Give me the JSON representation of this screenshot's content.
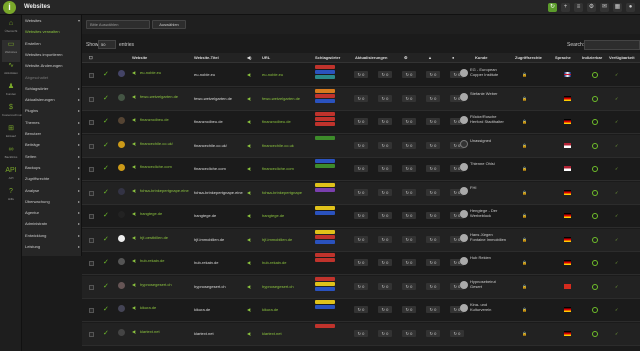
{
  "app": {
    "title": "Websites",
    "logo": "i"
  },
  "toolbar": {
    "icons": [
      "refresh-icon",
      "plus-icon",
      "list-icon",
      "gear-icon",
      "chat-icon",
      "grid-icon"
    ]
  },
  "leftnav": [
    {
      "label": "Übersicht",
      "icon": "home-icon"
    },
    {
      "label": "Websites",
      "icon": "monitor-icon"
    },
    {
      "label": "Aktivitäten",
      "icon": "activity-icon"
    },
    {
      "label": "Kunden",
      "icon": "users-icon"
    },
    {
      "label": "Kostenrechnung",
      "icon": "dollar-icon"
    },
    {
      "label": "Einkauf",
      "icon": "cart-icon"
    },
    {
      "label": "Backlinks",
      "icon": "link-icon"
    },
    {
      "label": "API",
      "icon": "api-icon"
    },
    {
      "label": "Hilfe",
      "icon": "help-icon"
    }
  ],
  "menu": [
    {
      "label": "Websites",
      "arrow": "▾"
    },
    {
      "label": "Websites verwalten",
      "arrow": ""
    },
    {
      "label": "Erstellen",
      "arrow": ""
    },
    {
      "label": "Websites importieren",
      "arrow": ""
    },
    {
      "label": "Website-Änderungen",
      "arrow": ""
    },
    {
      "label": "Abgeschaltet",
      "arrow": ""
    },
    {
      "label": "Schlagwörter",
      "arrow": "▸"
    },
    {
      "label": "Aktualisierungen",
      "arrow": "▸"
    },
    {
      "label": "Plugins",
      "arrow": "▸"
    },
    {
      "label": "Themes",
      "arrow": "▸"
    },
    {
      "label": "Benutzer",
      "arrow": "▸"
    },
    {
      "label": "Beiträge",
      "arrow": "▸"
    },
    {
      "label": "Seiten",
      "arrow": "▸"
    },
    {
      "label": "Backups",
      "arrow": "▸"
    },
    {
      "label": "Zugriffsrechte",
      "arrow": "▸"
    },
    {
      "label": "Analyse",
      "arrow": "▸"
    },
    {
      "label": "Überwachung",
      "arrow": "▸"
    },
    {
      "label": "Agentur",
      "arrow": "▸"
    },
    {
      "label": "Administratn",
      "arrow": "▸"
    },
    {
      "label": "Entwicklung",
      "arrow": "▸"
    },
    {
      "label": "Leistung",
      "arrow": "▸"
    }
  ],
  "filter": {
    "placeholder": "Bitte Auswählen",
    "button": "Auswählen"
  },
  "table_controls": {
    "show": "Show",
    "count": "50",
    "entries": "entries",
    "search": "Search:"
  },
  "columns": [
    "Website",
    "Website-Titel",
    "URL",
    "Schlagwörter",
    "Aktualisierungen",
    "Kunde",
    "Zugriffsrechte",
    "Sprache",
    "Indizierbar",
    "Verfügbarkeit"
  ],
  "rows": [
    {
      "site": "eu-noble.eu",
      "title": "eu-noble.eu",
      "url": "eu-noble.eu",
      "tags": [
        "red",
        "blue",
        "teal"
      ],
      "customer": "EG - European Copper Institute",
      "flag": "uk",
      "thumb": "#446"
    },
    {
      "site": "fewo-wetzelgarten.de",
      "title": "fewo-wetzelgarten.de",
      "url": "fewo-wetzelgarten.de",
      "tags": [
        "orange",
        "red",
        "blue"
      ],
      "customer": "Stefanie Weber",
      "flag": "de",
      "thumb": "#454"
    },
    {
      "site": "finanzrodbeu.de",
      "title": "finanzrodbeu.de",
      "url": "finanzrodbeu.de",
      "tags": [
        "red",
        "red",
        "red"
      ],
      "customer": "Flöcke/Rosche Herford Stadthalter",
      "flag": "de",
      "thumb": "#543"
    },
    {
      "site": "financechile.co.uk/",
      "title": "financechile.co.uk/",
      "url": "financechile.co.uk",
      "tags": [
        "green"
      ],
      "customer": "Unassigned",
      "flag": "us",
      "thumb": "#cc9a18"
    },
    {
      "site": "financecliche.com",
      "title": "financecliche.com",
      "url": "financecliche.com",
      "tags": [
        "blue",
        "green"
      ],
      "customer": "Thienne Ohlsi",
      "flag": "us",
      "thumb": "#cc9a18"
    },
    {
      "site": "fohsa-brinkepertgnape.eine",
      "title": "fohsa-brinkepertgnape.eine",
      "url": "fohsa-brinkepertgnape",
      "tags": [
        "yellow",
        "purple"
      ],
      "customer": "FHI",
      "flag": "de",
      "thumb": "#334"
    },
    {
      "site": "hangtege.de",
      "title": "hangtege.de",
      "url": "hangtege.de",
      "tags": [
        "yellow",
        "blue"
      ],
      "customer": "Hengtege - Der Werbeblock",
      "flag": "de",
      "thumb": "#222"
    },
    {
      "site": "hjf-oestbillen.de",
      "title": "hjf-immobilien.de",
      "url": "hjf-immobilien.de",
      "tags": [
        "yellow",
        "red",
        "blue"
      ],
      "customer": "Hans Jürgen Fontaine Immobilien",
      "flag": "de",
      "thumb": "#eee"
    },
    {
      "site": "hub-rekain.de",
      "title": "hub-rekain.de",
      "url": "hub-rekain.de",
      "tags": [
        "red",
        "red"
      ],
      "customer": "Hub Rekien",
      "flag": "de",
      "thumb": "#555"
    },
    {
      "site": "hypnosegesert.ch",
      "title": "hypnosegesert.ch",
      "url": "hypnosegesert.ch",
      "tags": [
        "red",
        "yellow",
        "blue"
      ],
      "customer": "Hypnosebeirut Gesert",
      "flag": "ch",
      "thumb": "#655"
    },
    {
      "site": "kikura.de",
      "title": "kikura.de",
      "url": "kikura.de",
      "tags": [
        "yellow",
        "blue"
      ],
      "customer": "Kina- und Kulturverein",
      "flag": "de",
      "thumb": "#445"
    },
    {
      "site": "klartext.net",
      "title": "klartext.net",
      "url": "klartext.net",
      "tags": [
        "red"
      ],
      "customer": "",
      "flag": "de",
      "thumb": "#444"
    }
  ],
  "colors": {
    "accent": "#8dc63f",
    "bg": "#1b1b1b",
    "red": "#c0332c",
    "blue": "#2a52be",
    "teal": "#2a8a8a",
    "orange": "#d77b1e",
    "green": "#3d8b2a",
    "yellow": "#e0c21a",
    "purple": "#7a3fae"
  }
}
